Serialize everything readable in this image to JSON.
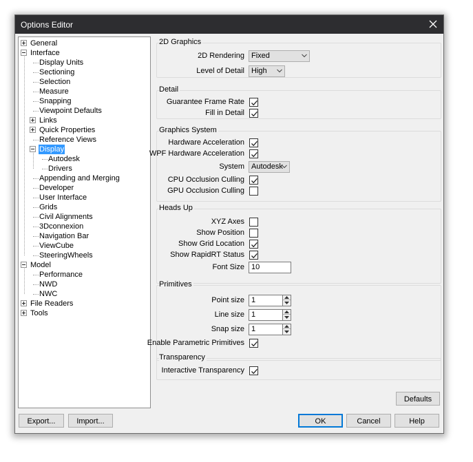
{
  "window": {
    "title": "Options Editor",
    "close_icon": "close-icon"
  },
  "tree": {
    "items": [
      {
        "label": "General",
        "level": 0,
        "expander": "plus"
      },
      {
        "label": "Interface",
        "level": 0,
        "expander": "minus"
      },
      {
        "label": "Display Units",
        "level": 1
      },
      {
        "label": "Sectioning",
        "level": 1
      },
      {
        "label": "Selection",
        "level": 1
      },
      {
        "label": "Measure",
        "level": 1
      },
      {
        "label": "Snapping",
        "level": 1
      },
      {
        "label": "Viewpoint Defaults",
        "level": 1
      },
      {
        "label": "Links",
        "level": 1,
        "expander": "plus"
      },
      {
        "label": "Quick Properties",
        "level": 1,
        "expander": "plus"
      },
      {
        "label": "Reference Views",
        "level": 1
      },
      {
        "label": "Display",
        "level": 1,
        "expander": "minus",
        "selected": true
      },
      {
        "label": "Autodesk",
        "level": 2
      },
      {
        "label": "Drivers",
        "level": 2
      },
      {
        "label": "Appending and Merging",
        "level": 1
      },
      {
        "label": "Developer",
        "level": 1
      },
      {
        "label": "User Interface",
        "level": 1
      },
      {
        "label": "Grids",
        "level": 1
      },
      {
        "label": "Civil Alignments",
        "level": 1
      },
      {
        "label": "3Dconnexion",
        "level": 1
      },
      {
        "label": "Navigation Bar",
        "level": 1
      },
      {
        "label": "ViewCube",
        "level": 1
      },
      {
        "label": "SteeringWheels",
        "level": 1
      },
      {
        "label": "Model",
        "level": 0,
        "expander": "minus"
      },
      {
        "label": "Performance",
        "level": 1
      },
      {
        "label": "NWD",
        "level": 1
      },
      {
        "label": "NWC",
        "level": 1
      },
      {
        "label": "File Readers",
        "level": 0,
        "expander": "plus"
      },
      {
        "label": "Tools",
        "level": 0,
        "expander": "plus"
      }
    ]
  },
  "graphics2d": {
    "title": "2D Graphics",
    "rendering_label": "2D Rendering",
    "rendering_value": "Fixed",
    "lod_label": "Level of Detail",
    "lod_value": "High"
  },
  "detail": {
    "title": "Detail",
    "guarantee_label": "Guarantee Frame Rate",
    "guarantee_checked": true,
    "fill_label": "Fill in Detail",
    "fill_checked": true
  },
  "graphics_system": {
    "title": "Graphics System",
    "hw_label": "Hardware Acceleration",
    "hw_checked": true,
    "wpf_label": "WPF Hardware Acceleration",
    "wpf_checked": true,
    "system_label": "System",
    "system_value": "Autodesk",
    "cpu_label": "CPU Occlusion Culling",
    "cpu_checked": true,
    "gpu_label": "GPU Occlusion Culling",
    "gpu_checked": false
  },
  "heads_up": {
    "title": "Heads Up",
    "xyz_label": "XYZ Axes",
    "xyz_checked": false,
    "position_label": "Show Position",
    "position_checked": false,
    "grid_label": "Show Grid Location",
    "grid_checked": true,
    "rapidrt_label": "Show RapidRT Status",
    "rapidrt_checked": true,
    "font_label": "Font Size",
    "font_value": "10"
  },
  "primitives": {
    "title": "Primitives",
    "point_label": "Point size",
    "point_value": "1",
    "line_label": "Line size",
    "line_value": "1",
    "snap_label": "Snap size",
    "snap_value": "1",
    "param_label": "Enable Parametric Primitives",
    "param_checked": true
  },
  "transparency": {
    "title": "Transparency",
    "interactive_label": "Interactive Transparency",
    "interactive_checked": true
  },
  "buttons": {
    "defaults": "Defaults",
    "export": "Export...",
    "import": "Import...",
    "ok": "OK",
    "cancel": "Cancel",
    "help": "Help"
  }
}
